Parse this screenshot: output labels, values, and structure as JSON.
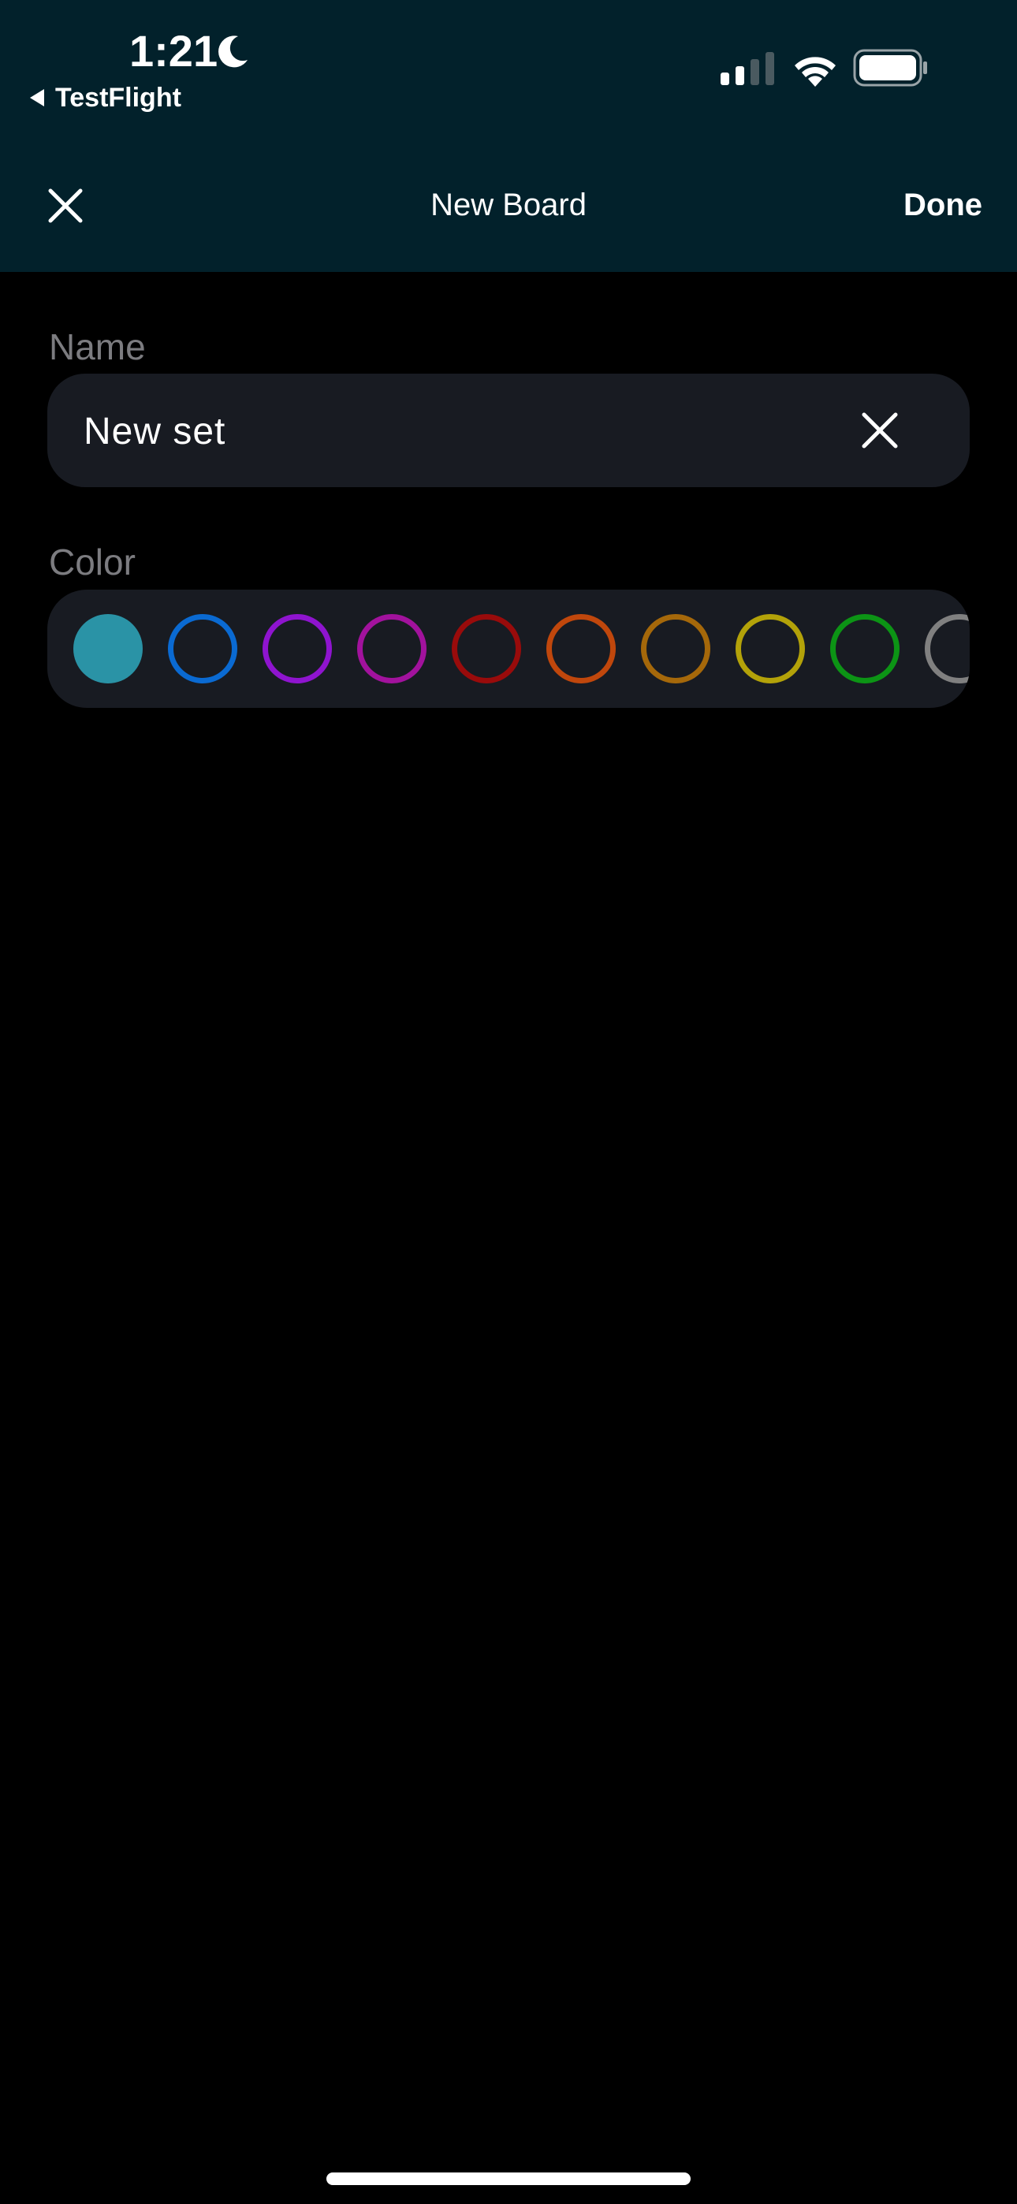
{
  "status_bar": {
    "time": "1:21",
    "back_app": "TestFlight"
  },
  "nav": {
    "title": "New Board",
    "done_label": "Done"
  },
  "form": {
    "name_label": "Name",
    "name_value": "New set",
    "color_label": "Color"
  },
  "colors": {
    "header_bg": "#02212b",
    "field_bg": "#181b22",
    "selected_swatch": "#2a93a6",
    "swatches": [
      "#2a93a6",
      "#0a6ad2",
      "#8f14cf",
      "#a2129d",
      "#990b0b",
      "#c0470c",
      "#a5680a",
      "#b3a209",
      "#0c9415",
      "#808080"
    ]
  }
}
